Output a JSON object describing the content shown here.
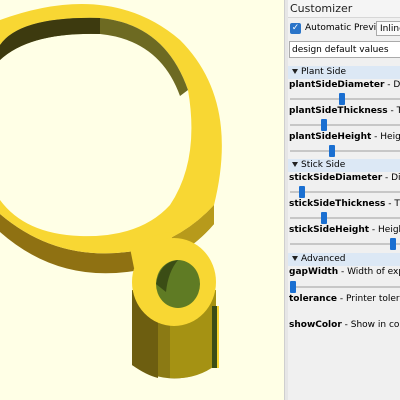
{
  "customizer": {
    "title": "Customizer",
    "automatic_preview": {
      "label": "Automatic Preview",
      "checked": true
    },
    "preview_mode": "Inline",
    "preset": "design default values",
    "sections": [
      {
        "name": "Plant Side",
        "params": [
          {
            "name": "plantSideDiameter",
            "desc": " - Diam",
            "slider": 0.43
          },
          {
            "name": "plantSideThickness",
            "desc": " - Thick",
            "slider": 0.27
          },
          {
            "name": "plantSideHeight",
            "desc": " - Height c",
            "slider": 0.34
          }
        ]
      },
      {
        "name": "Stick Side",
        "params": [
          {
            "name": "stickSideDiameter",
            "desc": " - Diame",
            "slider": 0.08
          },
          {
            "name": "stickSideThickness",
            "desc": " - Thick",
            "slider": 0.27
          },
          {
            "name": "stickSideHeight",
            "desc": " - Height o",
            "slider": 0.88
          }
        ]
      },
      {
        "name": "Advanced",
        "params": [
          {
            "name": "gapWidth",
            "desc": " - Width of expans",
            "slider": 0.0
          },
          {
            "name": "tolerance",
            "desc": " - Printer toleranc",
            "slider": null
          },
          {
            "name": "showColor",
            "desc": " - Show in color",
            "slider": null
          }
        ]
      }
    ]
  },
  "viewport": {
    "background": "#ffffe6",
    "model_color": "#f8d733",
    "model_shade": "#c8a819",
    "model_dark": "#7b5f1e",
    "inner_green": "#607d26"
  }
}
